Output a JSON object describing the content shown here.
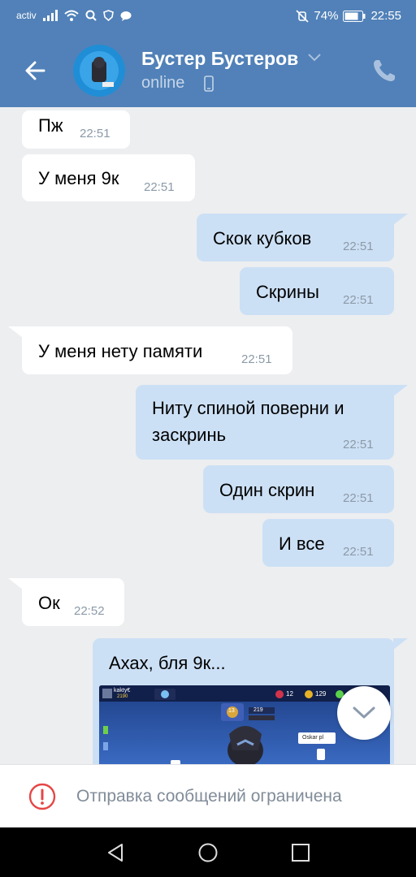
{
  "status_bar": {
    "carrier": "activ",
    "battery": "74%",
    "time": "22:55"
  },
  "header": {
    "name": "Бустер Бустеров",
    "status": "online"
  },
  "messages": [
    {
      "dir": "in",
      "text": "Пж",
      "time": "22:51"
    },
    {
      "dir": "in",
      "text": "У меня 9к",
      "time": "22:51"
    },
    {
      "dir": "out",
      "text": "Скок кубков",
      "time": "22:51"
    },
    {
      "dir": "out",
      "text": "Скрины",
      "time": "22:51"
    },
    {
      "dir": "in",
      "text": "У меня нету памяти",
      "time": "22:51"
    },
    {
      "dir": "out",
      "text_line1": "Ниту спиной поверни и",
      "text_line2": "заскринь",
      "time": "22:51"
    },
    {
      "dir": "out",
      "text": "Один скрин",
      "time": "22:51"
    },
    {
      "dir": "out",
      "text": "И все",
      "time": "22:51"
    },
    {
      "dir": "in",
      "text": "Ок",
      "time": "22:52"
    },
    {
      "dir": "out",
      "text": "Ахах, бля 9к..."
    }
  ],
  "screenshot": {
    "player_name": "kakty€",
    "trophies": "2190",
    "level": "13",
    "trophies2": "219",
    "gems": "12",
    "coins": "129",
    "friend": "Oskar pl"
  },
  "restricted_text": "Отправка сообщений ограничена",
  "colors": {
    "header": "#5181b8",
    "background": "#edeef0",
    "incoming": "#ffffff",
    "outgoing": "#cce0f5",
    "warning": "#e64646"
  }
}
